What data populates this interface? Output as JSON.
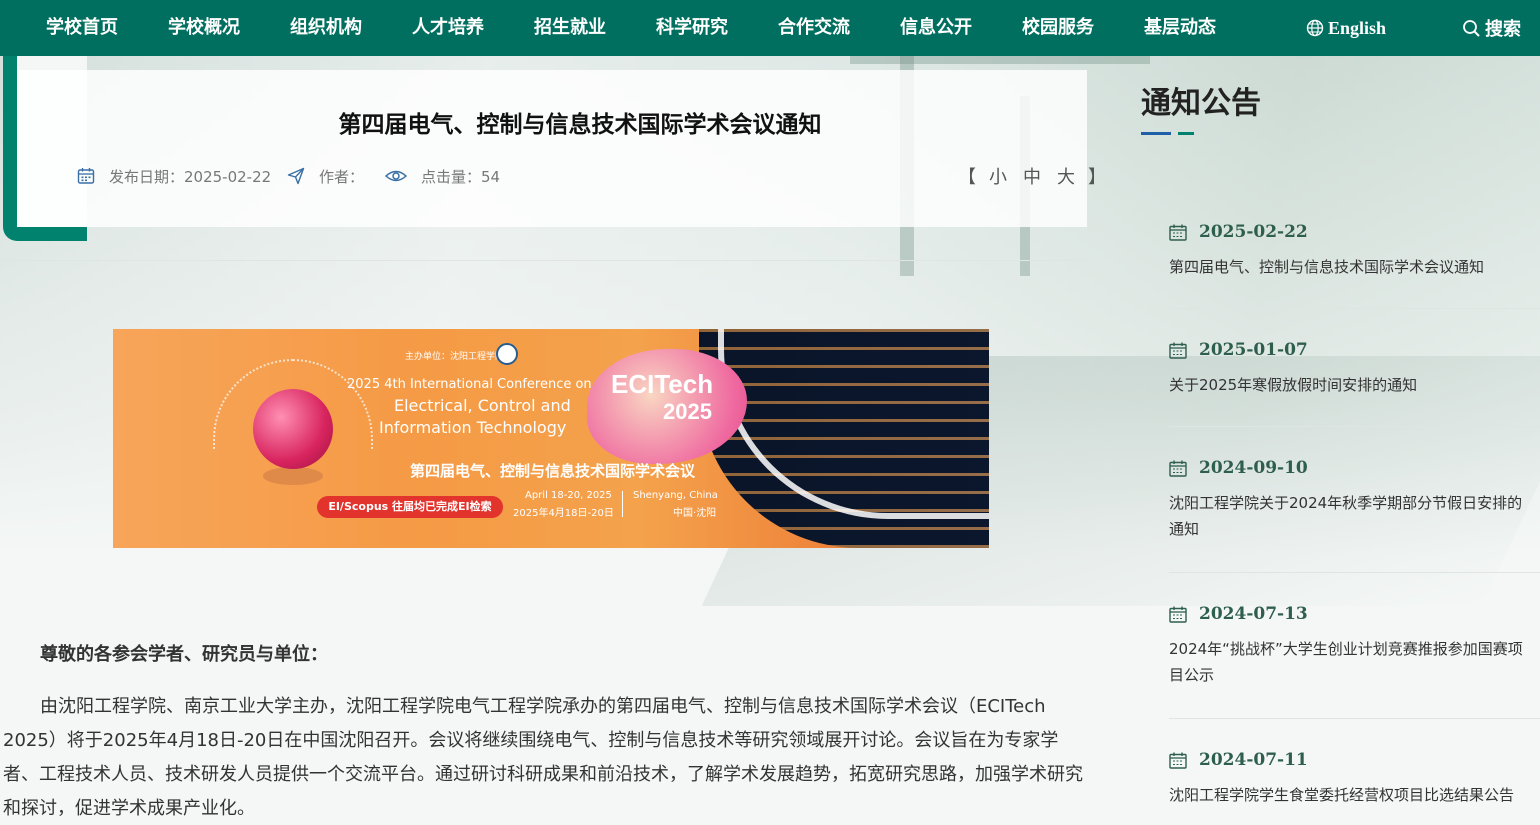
{
  "nav": {
    "items": [
      "学校首页",
      "学校概况",
      "组织机构",
      "人才培养",
      "招生就业",
      "科学研究",
      "合作交流",
      "信息公开",
      "校园服务",
      "基层动态"
    ],
    "english_label": "English",
    "search_label": "搜索",
    "icons": {
      "english": "globe-icon",
      "search": "search-icon"
    }
  },
  "article": {
    "title": "第四届电气、控制与信息技术国际学术会议通知",
    "publish_date_label": "发布日期：2025-02-22",
    "author_label": "作者：",
    "views_label": "点击量：54",
    "size_open": "【",
    "size_small": "小",
    "size_medium": "中",
    "size_large": "大",
    "size_close": "】",
    "greeting": "尊敬的各参会学者、研究员与单位：",
    "paragraph": "由沈阳工程学院、南京工业大学主办，沈阳工程学院电气工程学院承办的第四届电气、控制与信息技术国际学术会议（ECITech 2025）将于2025年4月18日-20日在中国沈阳召开。会议将继续围绕电气、控制与信息技术等研究领域展开讨论。会议旨在为专家学者、工程技术人员、技术研发人员提供一个交流平台。通过研讨科研成果和前沿技术，了解学术发展趋势，拓宽研究思路，加强学术研究和探讨，促进学术成果产业化。"
  },
  "banner": {
    "organizer": "主办单位：沈阳工程学院",
    "line1": "2025 4th International Conference on",
    "line2": "Electrical, Control and",
    "line3": "Information Technology",
    "brand1": "ECITech",
    "brand2": "2025",
    "cn_title": "第四届电气、控制与信息技术国际学术会议",
    "ei_badge": "EI/Scopus 往届均已完成EI检索",
    "date_en": "April 18-20, 2025",
    "date_cn": "2025年4月18日-20日",
    "loc_en": "Shenyang, China",
    "loc_cn": "中国·沈阳"
  },
  "sidebar": {
    "title": "通知公告",
    "notices": [
      {
        "date": "2025-02-22",
        "title": "第四届电气、控制与信息技术国际学术会议通知"
      },
      {
        "date": "2025-01-07",
        "title": "关于2025年寒假放假时间安排的通知"
      },
      {
        "date": "2024-09-10",
        "title": "沈阳工程学院关于2024年秋季学期部分节假日安排的通知"
      },
      {
        "date": "2024-07-13",
        "title": "2024年“挑战杯”大学生创业计划竞赛推报参加国赛项目公示"
      },
      {
        "date": "2024-07-11",
        "title": "沈阳工程学院学生食堂委托经营权项目比选结果公告"
      }
    ]
  },
  "colors": {
    "nav_bg": "#006f5f",
    "accent_green": "#00826e",
    "accent_blue": "#1f5fa8"
  }
}
